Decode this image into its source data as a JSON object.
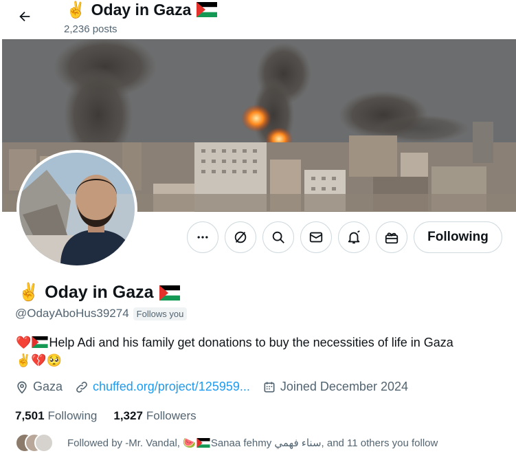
{
  "header": {
    "title_emoji": "✌️",
    "title": "Oday in Gaza",
    "posts_count": "2,236 posts"
  },
  "profile": {
    "name": "Oday in Gaza",
    "name_emoji": "✌️",
    "handle": "@OdayAboHus39274",
    "follows_you_badge": "Follows you",
    "bio_heart": "❤️",
    "bio_text": "Help Adi and his family get donations to buy the necessities of life in Gaza",
    "bio_emojis": "✌️💔🥺",
    "location": "Gaza",
    "link": "chuffed.org/project/125959...",
    "joined": "Joined December 2024",
    "following_count": "7,501",
    "following_label": "Following",
    "followers_count": "1,327",
    "followers_label": "Followers",
    "followed_by_prefix": "Followed by -Mr. Vandal, 🍉",
    "followed_by_rest": "Sanaa fehmy سناء فهمي, and 11 others you follow"
  },
  "actions": {
    "following_button": "Following"
  },
  "icons": [
    "back-arrow-icon",
    "more-icon",
    "grok-icon",
    "search-icon",
    "message-icon",
    "notification-bell-icon",
    "gift-icon",
    "location-icon",
    "link-icon",
    "calendar-icon"
  ],
  "colors": {
    "link": "#1d9bf0",
    "secondary_text": "#536471",
    "border": "#cfd9de"
  }
}
